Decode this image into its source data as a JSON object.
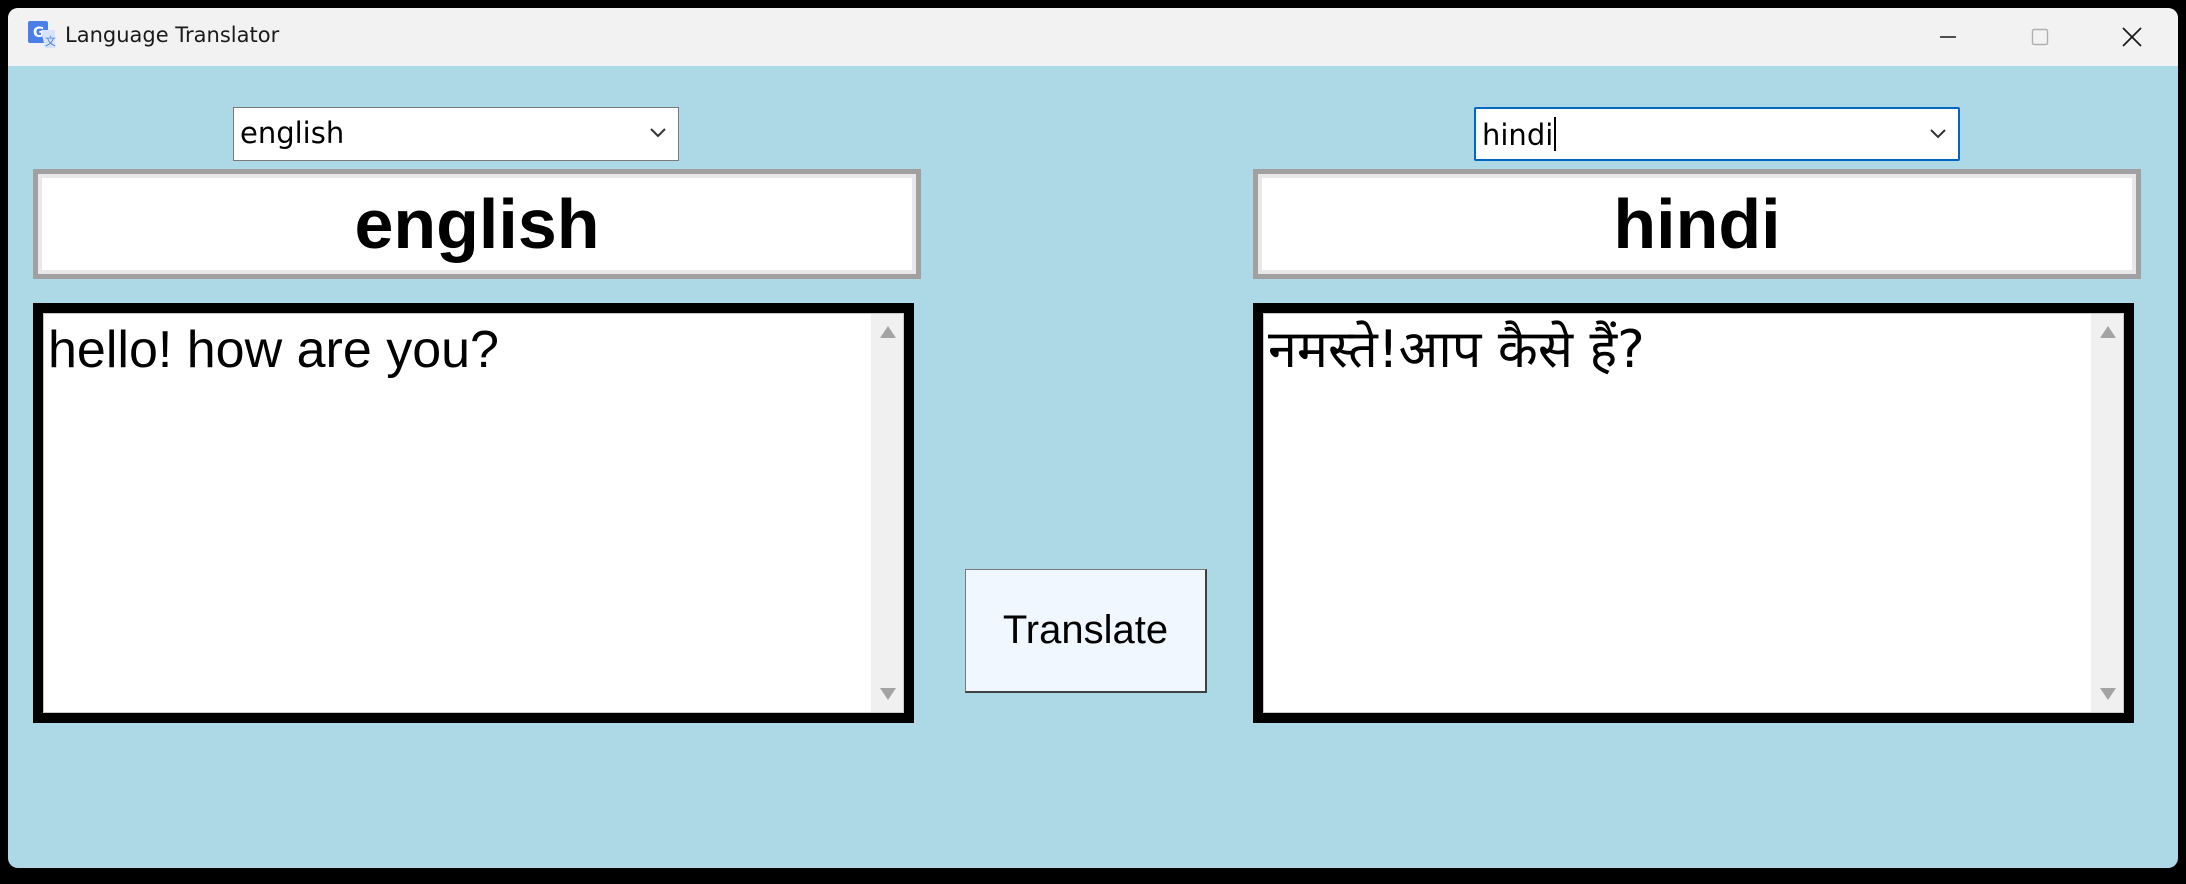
{
  "window": {
    "title": "Language Translator",
    "app_icon": "google-translate-icon",
    "controls": {
      "minimize": "minimize-icon",
      "maximize": "maximize-icon",
      "close": "close-icon"
    }
  },
  "source": {
    "select_value": "english",
    "label": "english",
    "text": "hello! how are you?"
  },
  "target": {
    "select_value": "hindi",
    "label": "hindi",
    "text": "नमस्ते!आप कैसे हैं?"
  },
  "actions": {
    "translate_label": "Translate"
  },
  "colors": {
    "background": "#add8e6",
    "titlebar": "#f2f2f2",
    "button": "#f0f7ff",
    "focus": "#0067c0"
  }
}
